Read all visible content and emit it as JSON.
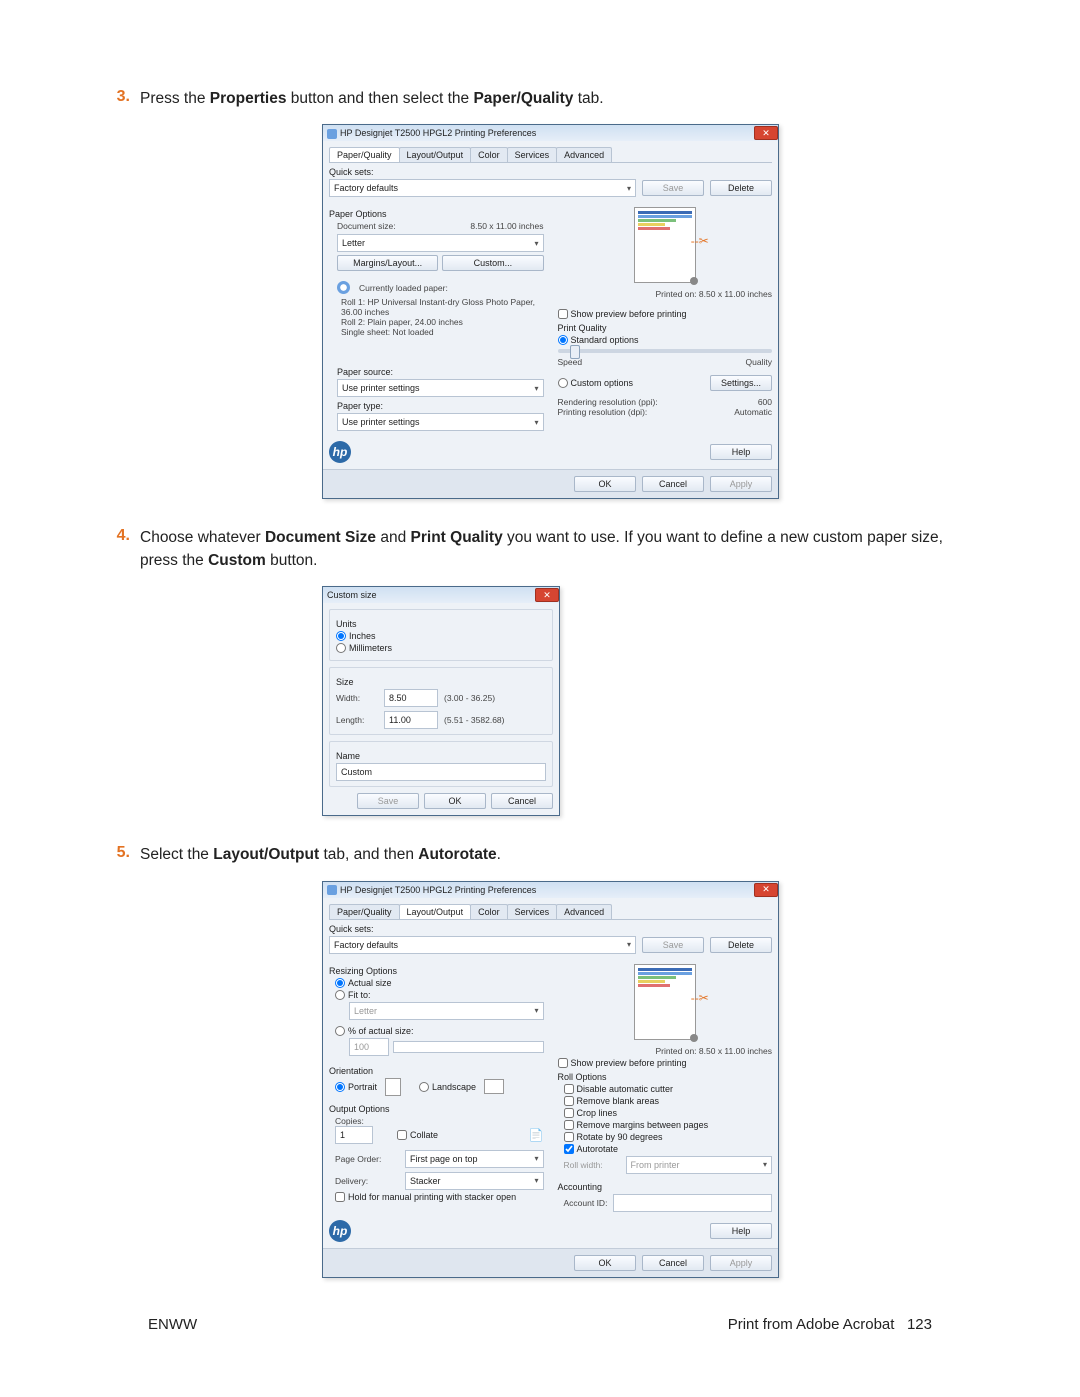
{
  "step3": {
    "num": "3.",
    "text_before": "Press the ",
    "b1": "Properties",
    "text_mid": " button and then select the ",
    "b2": "Paper/Quality",
    "text_after": " tab."
  },
  "step4": {
    "num": "4.",
    "text_before": "Choose whatever ",
    "b1": "Document Size",
    "text_mid": " and ",
    "b2": "Print Quality",
    "text_after": " you want to use. If you want to define a new custom paper size, press the ",
    "b3": "Custom",
    "text_end": " button."
  },
  "step5": {
    "num": "5.",
    "text_before": "Select the ",
    "b1": "Layout/Output",
    "text_mid": " tab, and then ",
    "b2": "Autorotate",
    "text_after": "."
  },
  "win1": {
    "title": "HP Designjet T2500 HPGL2 Printing Preferences",
    "tabs": [
      "Paper/Quality",
      "Layout/Output",
      "Color",
      "Services",
      "Advanced"
    ],
    "quicksets": "Quick sets:",
    "quicksets_val": "Factory defaults",
    "save": "Save",
    "delete": "Delete",
    "paper_options": "Paper Options",
    "doc_size": "Document size:",
    "doc_size_val": "8.50 x 11.00 inches",
    "doc_size_sel": "Letter",
    "margins": "Margins/Layout...",
    "custom": "Custom...",
    "loaded": "Currently loaded paper:",
    "roll1": "Roll 1: HP Universal Instant-dry Gloss Photo Paper, 36.00 inches",
    "roll2": "Roll 2: Plain paper, 24.00 inches",
    "sheet": "Single sheet: Not loaded",
    "paper_source": "Paper source:",
    "paper_source_val": "Use printer settings",
    "paper_type": "Paper type:",
    "paper_type_val": "Use printer settings",
    "printed_on": "Printed on: 8.50 x 11.00 inches",
    "show_prev": "Show preview before printing",
    "print_quality": "Print Quality",
    "std": "Standard options",
    "speed": "Speed",
    "quality": "Quality",
    "cust_opt": "Custom options",
    "settings": "Settings...",
    "rend": "Rendering resolution (ppi):",
    "rend_v": "600",
    "print_res": "Printing resolution (dpi):",
    "print_res_v": "Automatic",
    "help": "Help",
    "ok": "OK",
    "cancel": "Cancel",
    "apply": "Apply"
  },
  "win2": {
    "title": "Custom size",
    "units": "Units",
    "inches": "Inches",
    "mm": "Millimeters",
    "size": "Size",
    "width": "Width:",
    "width_v": "8.50",
    "width_r": "(3.00 - 36.25)",
    "length": "Length:",
    "length_v": "11.00",
    "length_r": "(5.51 - 3582.68)",
    "name": "Name",
    "name_v": "Custom",
    "save": "Save",
    "ok": "OK",
    "cancel": "Cancel"
  },
  "win3": {
    "title": "HP Designjet T2500 HPGL2 Printing Preferences",
    "tabs": [
      "Paper/Quality",
      "Layout/Output",
      "Color",
      "Services",
      "Advanced"
    ],
    "quicksets": "Quick sets:",
    "quicksets_val": "Factory defaults",
    "save": "Save",
    "delete": "Delete",
    "resize": "Resizing Options",
    "actual": "Actual size",
    "fit_to": "Fit to:",
    "fit_val": "Letter",
    "pct": "% of actual size:",
    "pct_v": "100",
    "orientation": "Orientation",
    "portrait": "Portrait",
    "landscape": "Landscape",
    "output": "Output Options",
    "copies": "Copies:",
    "copies_v": "1",
    "collate": "Collate",
    "page_order": "Page Order:",
    "page_order_v": "First page on top",
    "delivery": "Delivery:",
    "delivery_v": "Stacker",
    "hold": "Hold for manual printing with stacker open",
    "printed_on": "Printed on: 8.50 x 11.00 inches",
    "show_prev": "Show preview before printing",
    "roll_opt": "Roll Options",
    "disable_cutter": "Disable automatic cutter",
    "remove_blank": "Remove blank areas",
    "crop": "Crop lines",
    "remove_margins": "Remove margins between pages",
    "rotate90": "Rotate by 90 degrees",
    "autorotate": "Autorotate",
    "roll_width": "Roll width:",
    "roll_width_v": "From printer",
    "accounting": "Accounting",
    "account_id": "Account ID:",
    "help": "Help",
    "ok": "OK",
    "cancel": "Cancel",
    "apply": "Apply"
  },
  "footer": {
    "left": "ENWW",
    "right": "Print from Adobe Acrobat",
    "page": "123"
  }
}
